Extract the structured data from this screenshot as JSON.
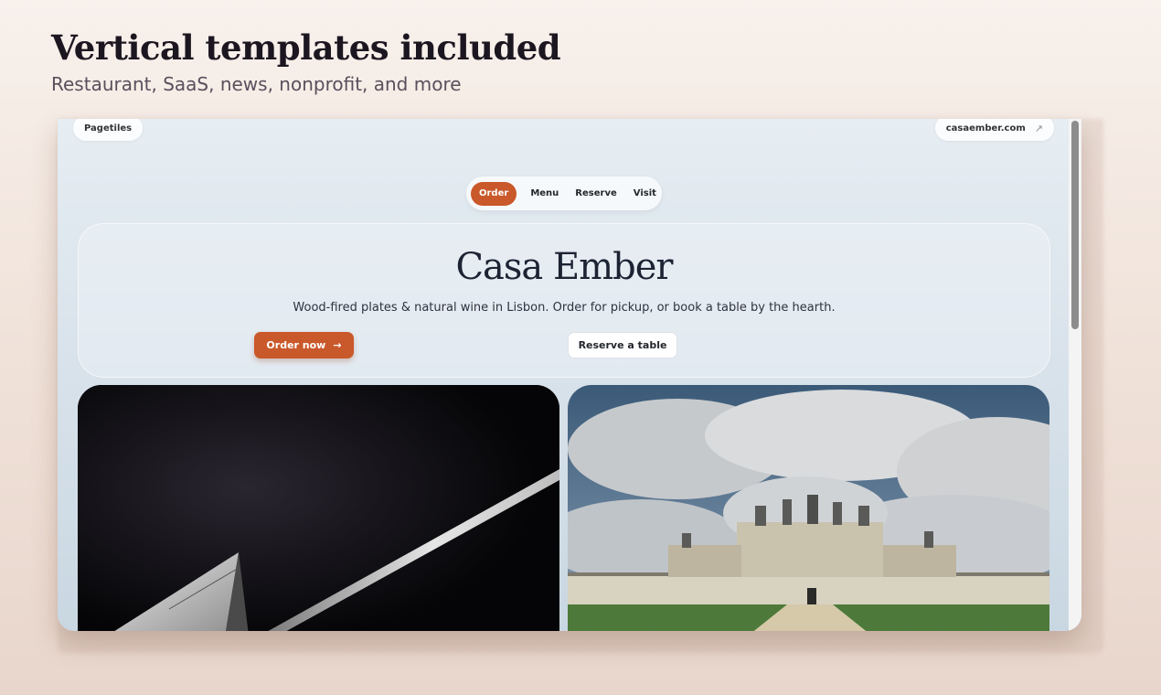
{
  "heading": "Vertical templates included",
  "subheading": "Restaurant, SaaS, news, nonprofit, and more",
  "browser": {
    "brand_chip": "Pagetiles",
    "domain_chip": "casaember.com",
    "domain_icon": "external-link-icon"
  },
  "nav": {
    "items": [
      {
        "label": "Order",
        "active": true
      },
      {
        "label": "Menu"
      },
      {
        "label": "Reserve"
      },
      {
        "label": "Visit"
      }
    ]
  },
  "hero": {
    "title": "Casa Ember",
    "description": "Wood-fired plates & natural wine in Lisbon. Order for pickup, or book a table by the hearth.",
    "primary_button": "Order now",
    "primary_button_arrow": "→",
    "secondary_button": "Reserve a table"
  },
  "images": {
    "left": "abstract-architecture-photo",
    "right": "chateau-photo"
  },
  "colors": {
    "accent": "#c9582a",
    "text_dark": "#1c1620"
  }
}
